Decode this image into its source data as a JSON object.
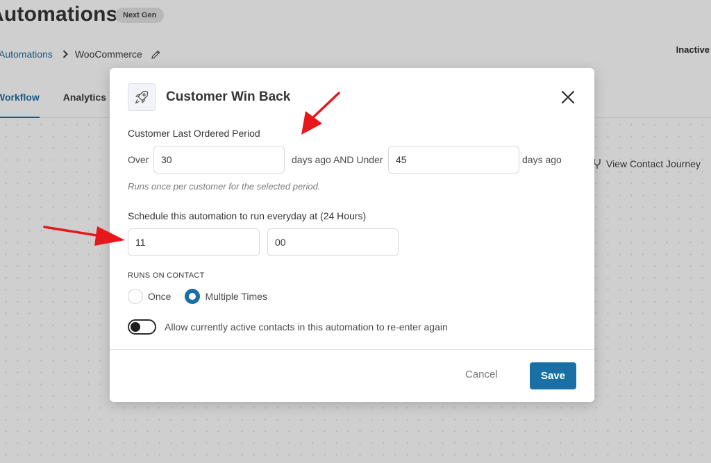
{
  "page": {
    "title": "Automations",
    "badge": "Next Gen",
    "breadcrumb": {
      "link": "Automations",
      "current": "WooCommerce"
    },
    "status": "Inactive",
    "tabs": [
      {
        "label": "Workflow",
        "active": true
      },
      {
        "label": "Analytics",
        "active": false
      }
    ],
    "view_contact_journey": "View Contact Journey"
  },
  "modal": {
    "title": "Customer Win Back",
    "period": {
      "label": "Customer Last Ordered Period",
      "over_text": "Over",
      "over_value": "30",
      "middle_text": "days ago AND Under",
      "under_value": "45",
      "suffix_text": "days ago",
      "helper": "Runs once per customer for the selected period."
    },
    "schedule": {
      "label": "Schedule this automation to run everyday at (24 Hours)",
      "hour": "11",
      "minute": "00"
    },
    "runs_on_contact": {
      "label": "RUNS ON CONTACT",
      "options": [
        {
          "label": "Once",
          "checked": false
        },
        {
          "label": "Multiple Times",
          "checked": true
        }
      ]
    },
    "reenter": {
      "label": "Allow currently active contacts in this automation to re-enter again",
      "enabled": false
    },
    "cancel_label": "Cancel",
    "save_label": "Save"
  },
  "colors": {
    "accent": "#1a6fa5",
    "annotation_arrow": "#e8171c",
    "overlay": "#cfcfcf"
  }
}
